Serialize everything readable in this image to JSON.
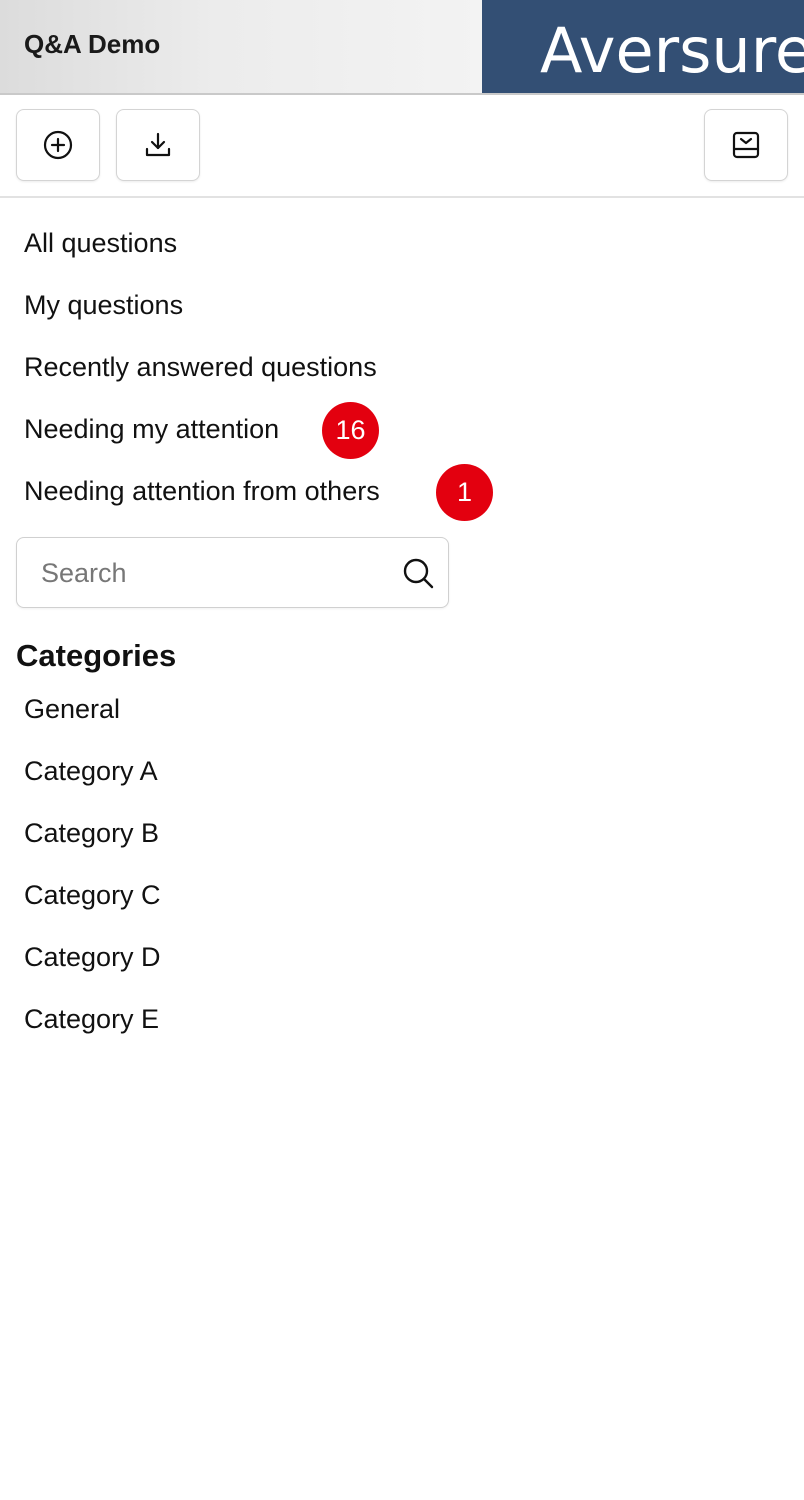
{
  "header": {
    "app_title": "Q&A Demo",
    "logo_text": "Aversure",
    "logo_bg_color": "#334f74"
  },
  "toolbar": {
    "buttons": [
      {
        "icon": "add-circle-icon",
        "action": "new question"
      },
      {
        "icon": "download-icon",
        "action": "download"
      },
      {
        "icon": "collapse-panel-icon",
        "action": "toggle panel"
      }
    ]
  },
  "nav": {
    "items": [
      {
        "label": "All questions"
      },
      {
        "label": "My questions"
      },
      {
        "label": "Recently answered questions"
      },
      {
        "label": "Needing my attention",
        "badge": "16"
      },
      {
        "label": "Needing attention from others",
        "badge": "1"
      }
    ],
    "badge_color": "#e3000f"
  },
  "search": {
    "placeholder": "Search",
    "value": ""
  },
  "categories": {
    "title": "Categories",
    "items": [
      {
        "label": "General"
      },
      {
        "label": "Category A"
      },
      {
        "label": "Category B"
      },
      {
        "label": "Category C"
      },
      {
        "label": "Category D"
      },
      {
        "label": "Category E"
      }
    ]
  }
}
